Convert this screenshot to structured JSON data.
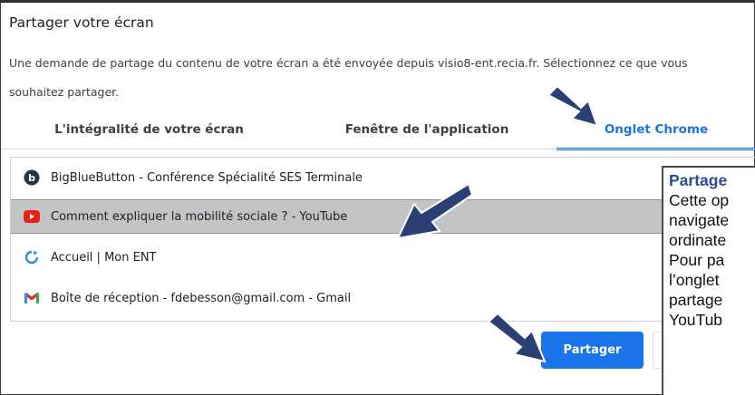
{
  "dialog": {
    "title": "Partager votre écran",
    "description": "Une demande de partage du contenu de votre écran a été envoyée depuis visio8-ent.recia.fr. Sélectionnez ce que vous souhaitez partager."
  },
  "tabs": [
    {
      "label": "L'intégralité de votre écran",
      "selected": false
    },
    {
      "label": "Fenêtre de l'application",
      "selected": false
    },
    {
      "label": "Onglet Chrome",
      "selected": true
    }
  ],
  "list": {
    "items": [
      {
        "label": "BigBlueButton - Conférence Spécialité SES Terminale",
        "icon": "bigbluebutton-icon",
        "selected": false
      },
      {
        "label": "Comment expliquer la mobilité sociale ? - YouTube",
        "icon": "youtube-icon",
        "selected": true
      },
      {
        "label": "Accueil | Mon ENT",
        "icon": "ent-icon",
        "selected": false
      },
      {
        "label": "Boîte de réception - fdebesson@gmail.com - Gmail",
        "icon": "gmail-icon",
        "selected": false
      }
    ]
  },
  "buttons": {
    "share_label": "Partager"
  },
  "callout": {
    "title": "Partage",
    "lines": [
      "Cette op",
      "navigate",
      "ordinate",
      "Pour pa",
      "l’onglet",
      "partage",
      "YouTub"
    ]
  },
  "colors": {
    "accent": "#1a73e8",
    "selected_row": "#c3c4c6",
    "callout_title": "#2e4b8f",
    "arrow": "#2a3f73"
  }
}
